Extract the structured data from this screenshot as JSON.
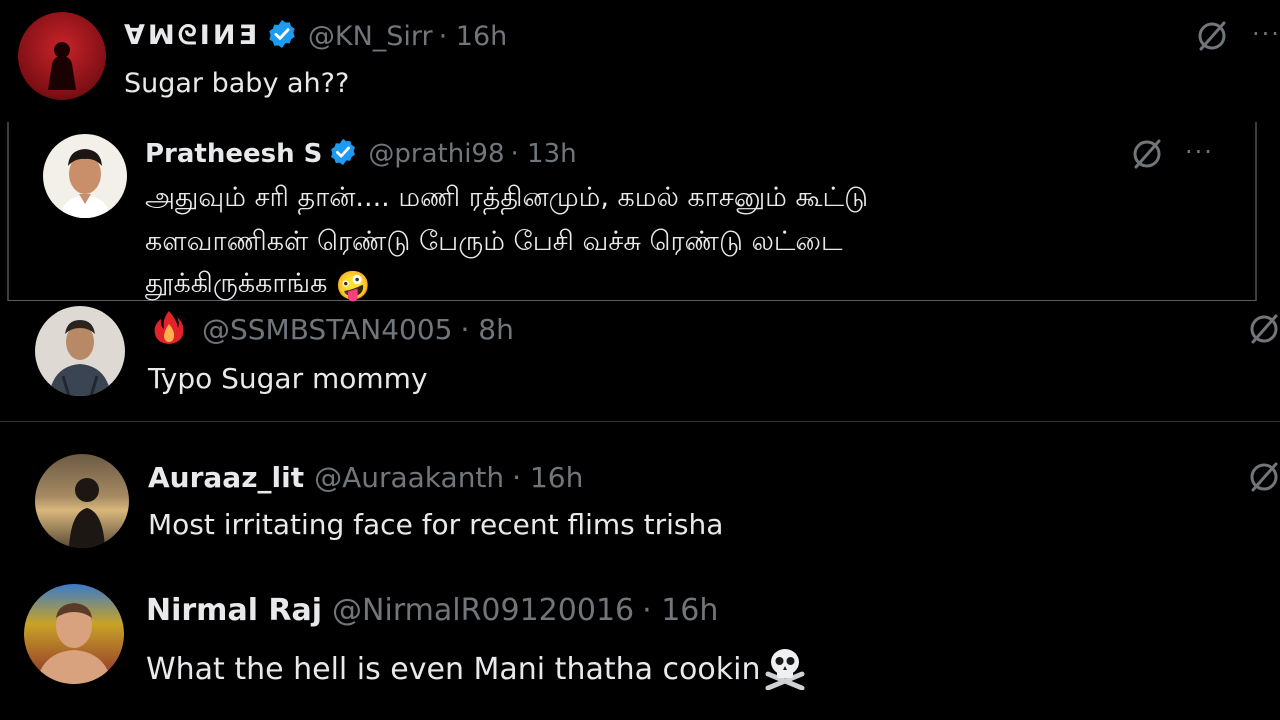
{
  "post1": {
    "display_name": "ꓯꟽᘓIИƎ",
    "handle": "@KN_Sirr",
    "time": "· 16h",
    "text": "Sugar baby ah??"
  },
  "quoted": {
    "display_name": "Pratheesh S",
    "handle": "@prathi98",
    "time": "· 13h",
    "line1": "அதுவும் சரி தான்.... மணி ரத்தினமும், கமல் காசனும் கூட்டு",
    "line2": "களவாணிகள் ரெண்டு பேரும் பேசி வச்சு ரெண்டு லட்டை",
    "line3": "தூக்கிருக்காங்க",
    "emoji": "🤪"
  },
  "reply1": {
    "handle": "@SSMBSTAN4005",
    "time": "· 8h",
    "text": "Typo Sugar mommy"
  },
  "reply2": {
    "display_name": "Auraaz_lit",
    "handle": "@Auraakanth",
    "time": "· 16h",
    "text": "Most irritating face for recent flims trisha"
  },
  "reply3": {
    "display_name": "Nirmal Raj",
    "handle": "@NirmalR09120016",
    "time": "· 16h",
    "text": "What the hell is even Mani thatha cookin"
  },
  "colors": {
    "background": "#000000",
    "text": "#e7e9ea",
    "muted": "#71767b",
    "verified": "#1d9bf0",
    "divider": "#2f3336"
  },
  "icons": [
    "grok-icon",
    "more-icon",
    "verified-badge-icon",
    "fire-icon",
    "skull-crossbones-icon"
  ]
}
